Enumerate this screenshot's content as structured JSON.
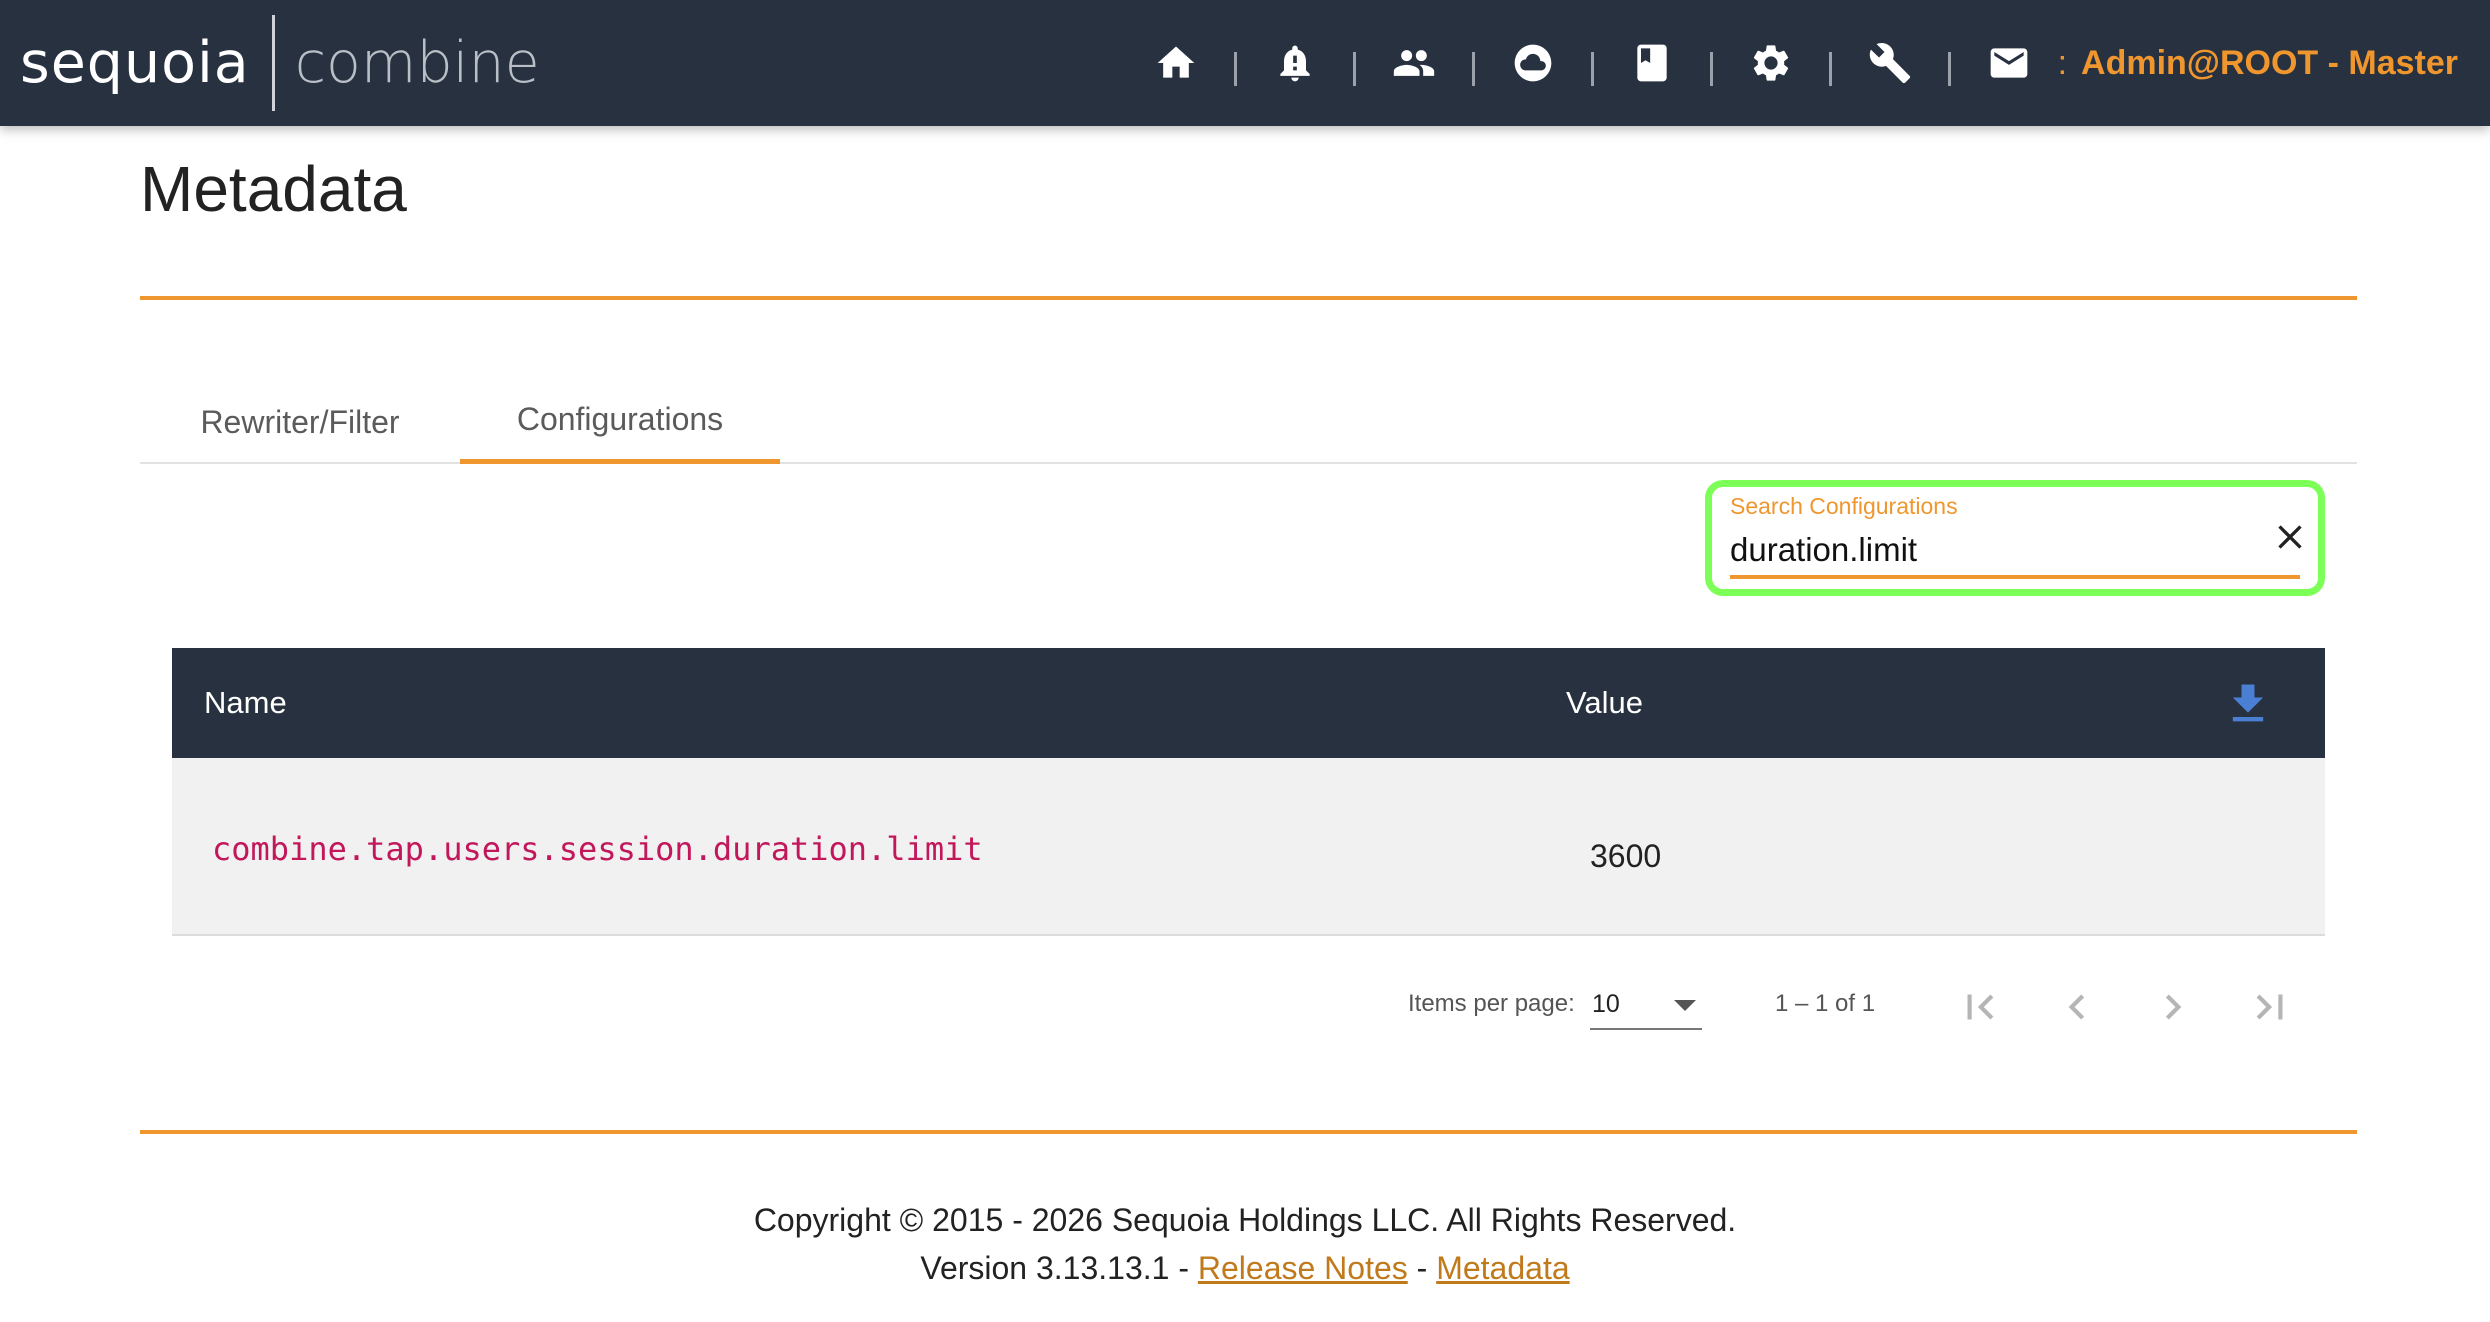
{
  "brand": {
    "name_left": "sequoia",
    "name_right": "combine"
  },
  "nav": {
    "icons": [
      "home-icon",
      "bell-icon",
      "users-icon",
      "cloud-icon",
      "book-icon",
      "gear-icon",
      "wrench-icon",
      "mail-icon"
    ],
    "separator": ":",
    "user_label": "Admin@ROOT - Master"
  },
  "page": {
    "title": "Metadata"
  },
  "tabs": [
    {
      "label": "Rewriter/Filter",
      "active": false
    },
    {
      "label": "Configurations",
      "active": true
    }
  ],
  "search": {
    "label": "Search Configurations",
    "value": "duration.limit"
  },
  "table": {
    "columns": [
      "Name",
      "Value"
    ],
    "rows": [
      {
        "name": "combine.tap.users.session.duration.limit",
        "value": "3600"
      }
    ]
  },
  "paginator": {
    "items_per_page_label": "Items per page:",
    "items_per_page_value": "10",
    "range_label": "1 – 1 of 1"
  },
  "footer": {
    "copyright": "Copyright © 2015 - 2026 Sequoia Holdings LLC. All Rights Reserved.",
    "version_prefix": "Version 3.13.13.1 - ",
    "release_notes_link": "Release Notes",
    "link_separator": " - ",
    "metadata_link": "Metadata"
  },
  "colors": {
    "topbar": "#27313f",
    "accent_orange": "#f0962e",
    "highlight_green": "#7cff57",
    "config_name_pink": "#c2185b",
    "download_blue": "#4a7fd4"
  }
}
